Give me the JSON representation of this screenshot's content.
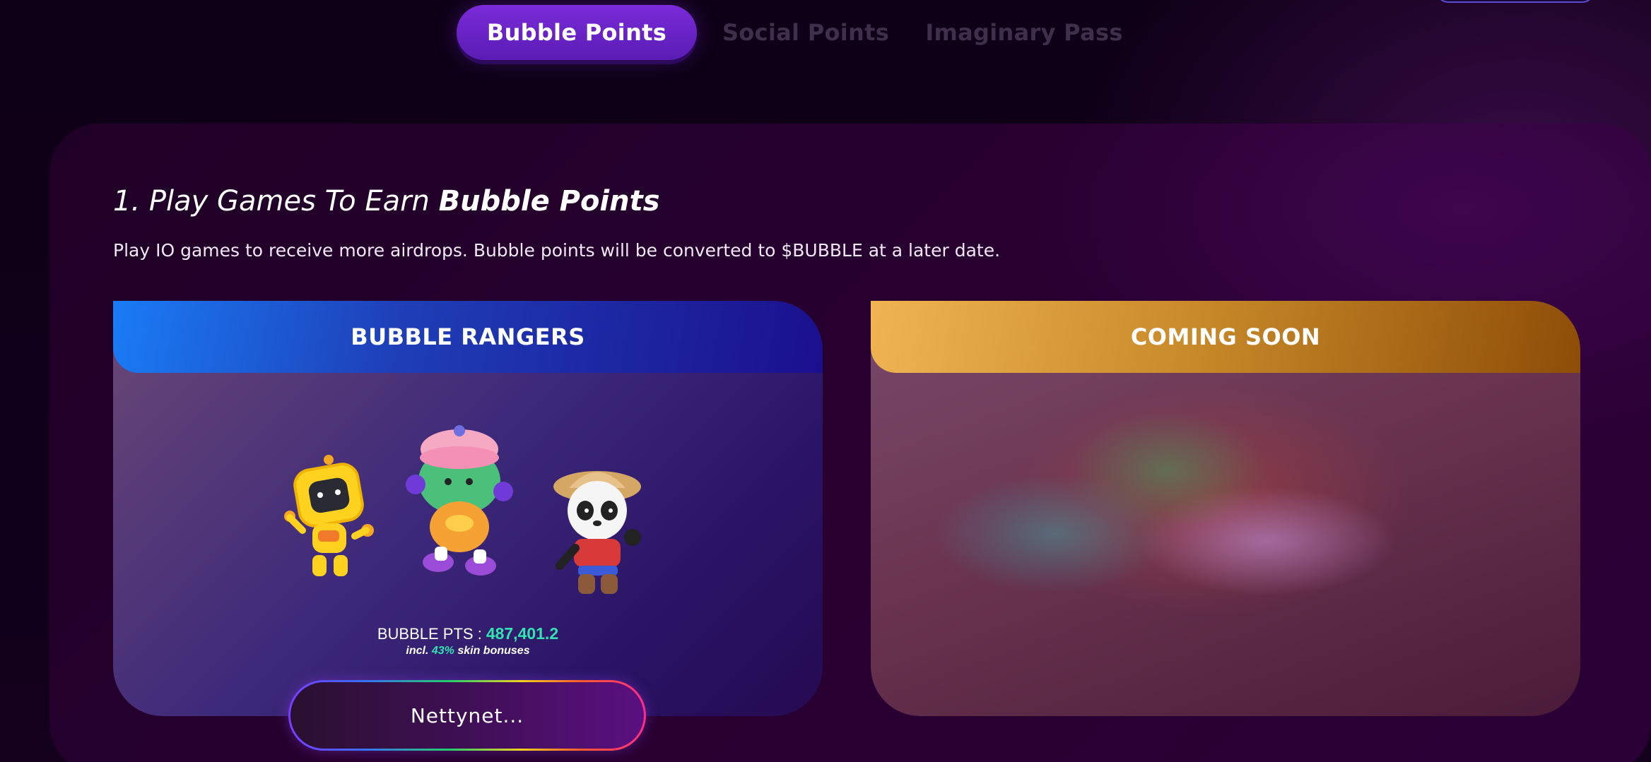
{
  "tabs": [
    {
      "label": "Bubble Points",
      "active": true
    },
    {
      "label": "Social Points",
      "active": false
    },
    {
      "label": "Imaginary Pass",
      "active": false
    }
  ],
  "section": {
    "heading_prefix": "1. Play Games To Earn ",
    "heading_bold": "Bubble Points",
    "subtitle": "Play IO games to receive more airdrops. Bubble points will be converted to $BUBBLE at a later date."
  },
  "cards": [
    {
      "title": "BUBBLE RANGERS",
      "points_label": "BUBBLE PTS :",
      "points_value": "487,401.2",
      "bonus_prefix": "incl.",
      "bonus_pct": "43%",
      "bonus_suffix": "skin bonuses"
    },
    {
      "title": "COMING SOON"
    }
  ],
  "user_button": {
    "label": "Nettynet..."
  },
  "colors": {
    "accent_green": "#33e3b2",
    "tab_active": "#6a24c8",
    "card_blue": "#1a7cf5",
    "card_gold": "#c98a2a"
  },
  "icons": [
    "yellow-robot-character",
    "green-girl-character",
    "panda-ranger-character"
  ]
}
